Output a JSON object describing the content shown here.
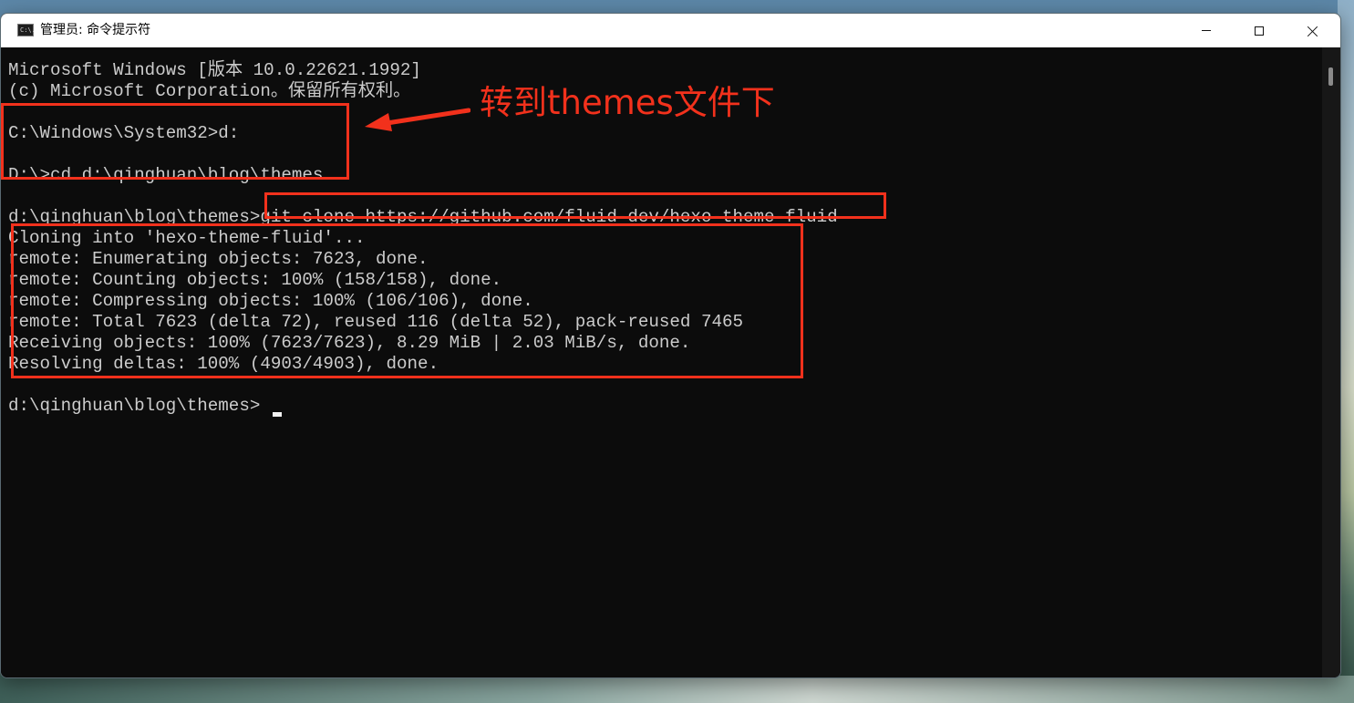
{
  "window": {
    "title": "管理员: 命令提示符",
    "icon": "cmd-icon",
    "icon_text": "C:\\."
  },
  "controls": {
    "minimize": "minimize-icon",
    "maximize": "maximize-icon",
    "close": "close-icon"
  },
  "console_lines": [
    "Microsoft Windows [版本 10.0.22621.1992]",
    "(c) Microsoft Corporation。保留所有权利。",
    "",
    "C:\\Windows\\System32>d:",
    "",
    "D:\\>cd d:\\qinghuan\\blog\\themes",
    "",
    "d:\\qinghuan\\blog\\themes>git clone https://github.com/fluid-dev/hexo-theme-fluid",
    "Cloning into 'hexo-theme-fluid'...",
    "remote: Enumerating objects: 7623, done.",
    "remote: Counting objects: 100% (158/158), done.",
    "remote: Compressing objects: 100% (106/106), done.",
    "remote: Total 7623 (delta 72), reused 116 (delta 52), pack-reused 7465",
    "Receiving objects: 100% (7623/7623), 8.29 MiB | 2.03 MiB/s, done.",
    "Resolving deltas: 100% (4903/4903), done.",
    "",
    "d:\\qinghuan\\blog\\themes>"
  ],
  "annotation": {
    "text": "转到themes文件下",
    "color": "#f2311c"
  },
  "colors": {
    "console_bg": "#0c0c0c",
    "console_fg": "#cccccc",
    "highlight": "#f2311c"
  }
}
